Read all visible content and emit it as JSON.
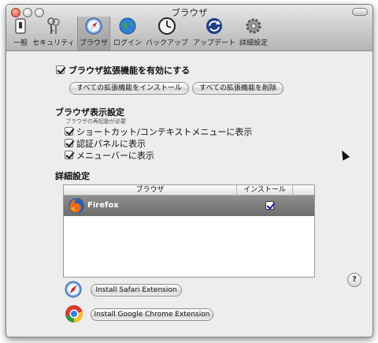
{
  "window": {
    "title": "ブラウザ"
  },
  "toolbar": {
    "items": [
      {
        "label": "一般",
        "icon": "switch-icon"
      },
      {
        "label": "セキュリティ",
        "icon": "keys-icon"
      },
      {
        "label": "ブラウザ",
        "icon": "safari-compass-icon",
        "selected": true
      },
      {
        "label": "ログイン",
        "icon": "globe-icon"
      },
      {
        "label": "バックアップ",
        "icon": "clock-icon"
      },
      {
        "label": "アップデート",
        "icon": "update-arrows-icon"
      },
      {
        "label": "詳細設定",
        "icon": "gear-icon"
      }
    ]
  },
  "main": {
    "enable_extensions": {
      "label": "ブラウザ拡張機能を有効にする",
      "checked": true
    },
    "install_all_button": "すべての拡張機能をインストール",
    "remove_all_button": "すべての拡張機能を削除",
    "display_settings": {
      "heading": "ブラウザ表示設定",
      "note": "ブラウザの再起動が必要",
      "options": [
        {
          "label": "ショートカット/コンテキストメニューに表示",
          "checked": true
        },
        {
          "label": "認証パネルに表示",
          "checked": true
        },
        {
          "label": "メニューバーに表示",
          "checked": true
        }
      ]
    },
    "advanced": {
      "heading": "詳細設定",
      "table": {
        "columns": [
          "ブラウザ",
          "インストール"
        ],
        "rows": [
          {
            "browser": "Firefox",
            "installed": true,
            "selected": true
          }
        ]
      }
    },
    "install_safari_button": "Install Safari Extension",
    "install_chrome_button": "Install Google Chrome Extension",
    "help": "?"
  },
  "colors": {
    "selected_row": "#7a7a7a",
    "window_bg": "#ededed"
  }
}
